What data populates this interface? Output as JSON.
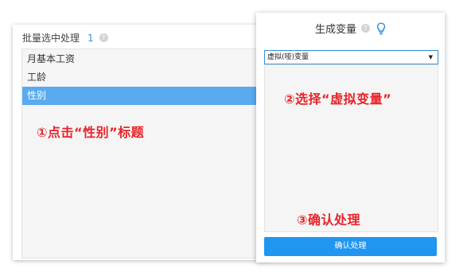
{
  "batch_panel": {
    "title": "批量选中处理",
    "count": "1",
    "help_glyph": "?",
    "items": [
      {
        "label": "月基本工资",
        "selected": false
      },
      {
        "label": "工龄",
        "selected": false
      },
      {
        "label": "性别",
        "selected": true
      }
    ]
  },
  "variable_panel": {
    "title": "生成变量",
    "help_glyph": "?",
    "select_value": "虚拟(哑)变量",
    "select_arrow": "▼",
    "confirm_label": "确认处理"
  },
  "annotations": {
    "step1": "①点击“性别”标题",
    "step2": "②选择“虚拟变量”",
    "step3": "③确认处理"
  },
  "colors": {
    "accent": "#2196f0",
    "selected_row": "#5aaaf0",
    "annotation": "#e8242a",
    "count_text": "#2f8fe0"
  },
  "icons": {
    "help": "help-icon",
    "hint": "lightbulb-icon",
    "dropdown": "chevron-down-icon"
  }
}
